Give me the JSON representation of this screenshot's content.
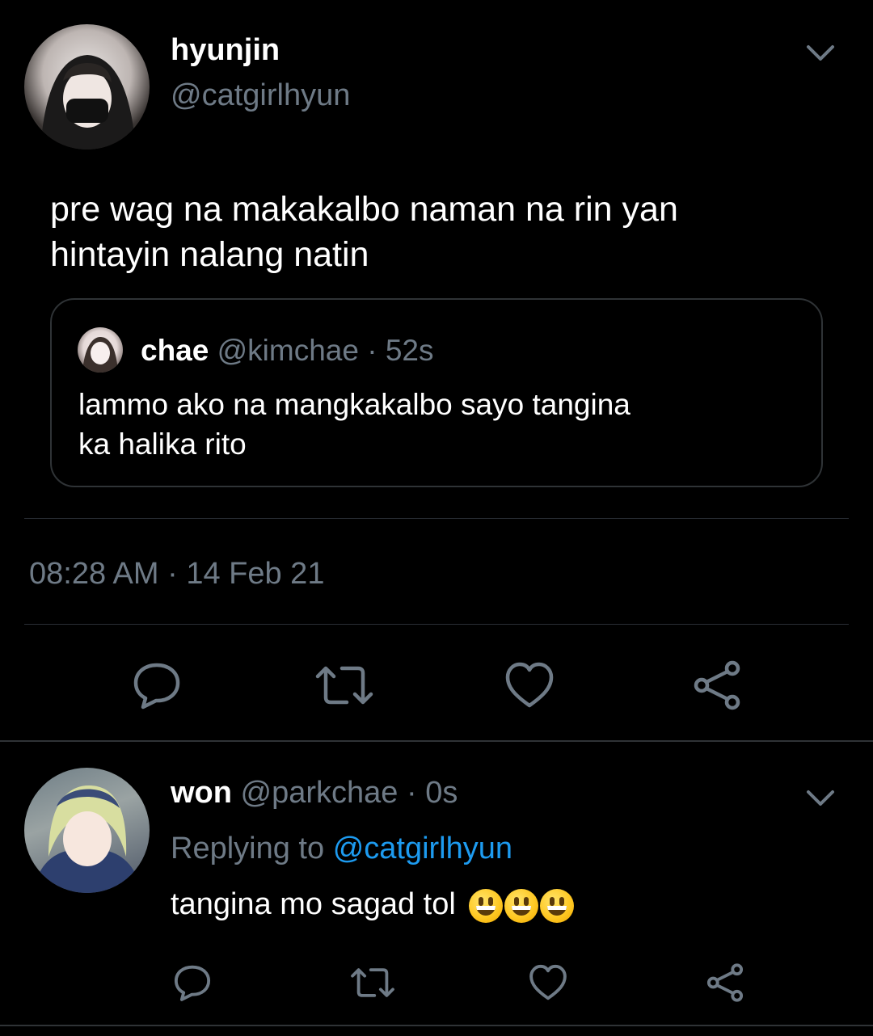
{
  "tweet": {
    "author_name": "hyunjin",
    "author_handle": "@catgirlhyun",
    "text_line1": "pre wag na makakalbo naman na rin yan",
    "text_line2": "hintayin nalang natin",
    "timestamp": "08:28 AM · 14 Feb 21",
    "quote": {
      "author_name": "chae",
      "author_handle": "@kimchae",
      "time": "· 52s",
      "text_line1": "lammo ako na mangkakalbo sayo tangina",
      "text_line2": "ka halika rito"
    }
  },
  "reply": {
    "author_name": "won",
    "author_handle": "@parkchae",
    "time": "· 0s",
    "replying_prefix": "Replying to",
    "replying_handle": "@catgirlhyun",
    "text": "tangina mo sagad tol"
  },
  "colors": {
    "background": "#000000",
    "muted": "#6e7a86",
    "link": "#1d9bf0",
    "divider": "#2f3336"
  },
  "icons": [
    "chevron-down-icon",
    "reply-icon",
    "retweet-icon",
    "like-icon",
    "share-icon",
    "grinning-emoji"
  ]
}
